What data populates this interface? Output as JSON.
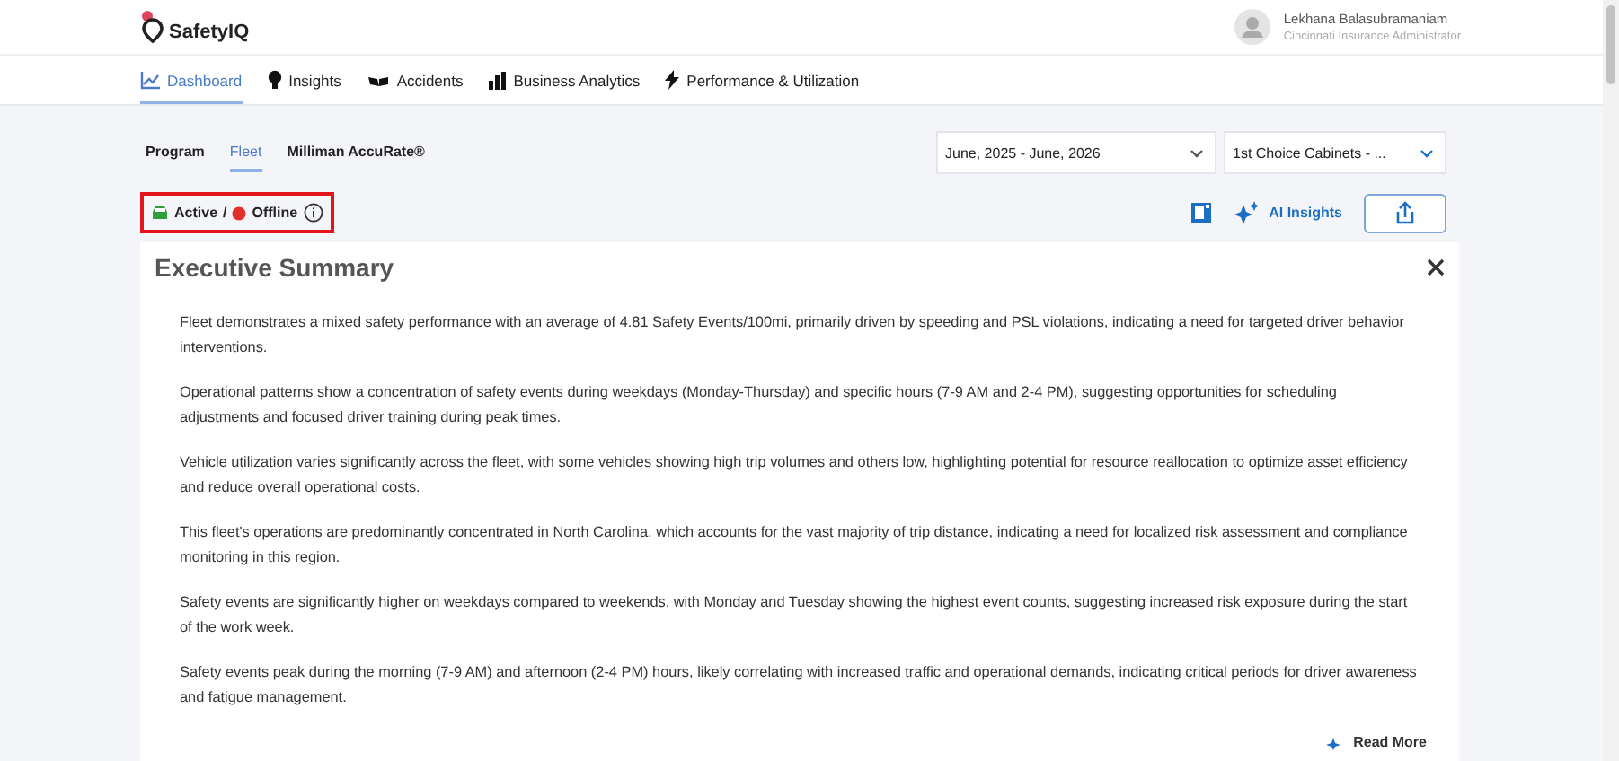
{
  "brand": {
    "name": "SafetyIQ"
  },
  "user": {
    "name": "Lekhana Balasubramaniam",
    "role": "Cincinnati Insurance Administrator"
  },
  "nav": [
    {
      "label": "Dashboard",
      "kind": "chart",
      "selected": true
    },
    {
      "label": "Insights",
      "kind": "bulb",
      "selected": false
    },
    {
      "label": "Accidents",
      "kind": "crash",
      "selected": false
    },
    {
      "label": "Business Analytics",
      "kind": "bars",
      "selected": false
    },
    {
      "label": "Performance & Utilization",
      "kind": "bolt",
      "selected": false
    }
  ],
  "sub_tabs": [
    {
      "label": "Program",
      "selected": false
    },
    {
      "label": "Fleet",
      "selected": true
    },
    {
      "label": "Milliman AccuRate®",
      "selected": false
    }
  ],
  "filters": [
    {
      "value": "June, 2025 - June, 2026"
    },
    {
      "value": "1st Choice Cabinets - ..."
    }
  ],
  "status": {
    "active": "Active",
    "separator": "/",
    "offline": "Offline",
    "highlighted": true
  },
  "actions": {
    "ai_insights": "AI Insights"
  },
  "summary": {
    "title": "Executive Summary",
    "paragraphs": [
      "Fleet demonstrates a mixed safety performance with an average of 4.81 Safety Events/100mi, primarily driven by speeding and PSL violations, indicating a need for targeted driver behavior interventions.",
      "Operational patterns show a concentration of safety events during weekdays (Monday-Thursday) and specific hours (7-9 AM and 2-4 PM), suggesting opportunities for scheduling adjustments and focused driver training during peak times.",
      "Vehicle utilization varies significantly across the fleet, with some vehicles showing high trip volumes and others low, highlighting potential for resource reallocation to optimize asset efficiency and reduce overall operational costs.",
      "This fleet's operations are predominantly concentrated in North Carolina, which accounts for the vast majority of trip distance, indicating a need for localized risk assessment and compliance monitoring in this region.",
      "Safety events are significantly higher on weekdays compared to weekends, with Monday and Tuesday showing the highest event counts, suggesting increased risk exposure during the start of the work week.",
      "Safety events peak during the morning (7-9 AM) and afternoon (2-4 PM) hours, likely correlating with increased traffic and operational demands, indicating critical periods for driver awareness and fatigue management."
    ],
    "read_more": "Read More"
  }
}
